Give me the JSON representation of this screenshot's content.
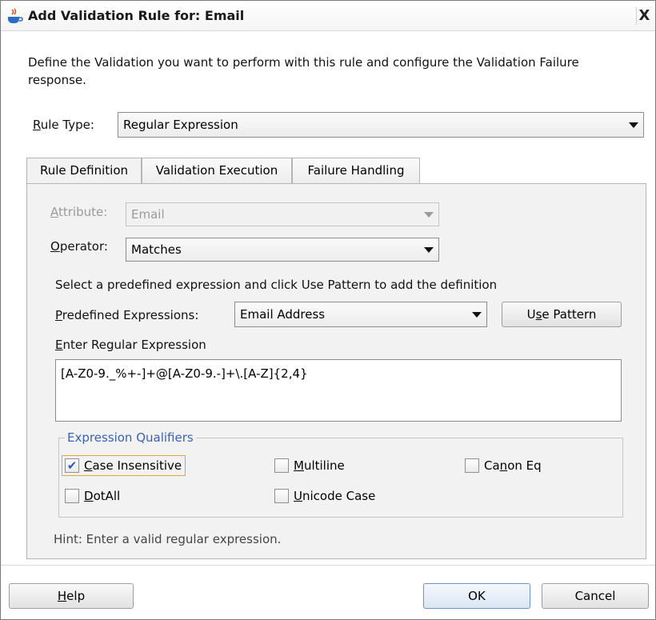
{
  "window": {
    "title": "Add Validation Rule for: Email",
    "close_label": "X",
    "app_icon": "java-cup-icon"
  },
  "description": "Define the Validation you want to perform with this rule and configure the Validation Failure response.",
  "rule_type": {
    "label_mnemonic": "R",
    "label_rest": "ule Type:",
    "value": "Regular Expression"
  },
  "tabs": [
    {
      "label": "Rule Definition",
      "active": true
    },
    {
      "label": "Validation Execution",
      "active": false
    },
    {
      "label": "Failure Handling",
      "active": false
    }
  ],
  "attribute": {
    "label_mnemonic": "A",
    "label_rest": "ttribute:",
    "value": "Email",
    "disabled": true
  },
  "operator": {
    "label_mnemonic": "O",
    "label_rest": "perator:",
    "value": "Matches"
  },
  "predefined_instruction": "Select a predefined expression and click Use Pattern to add the definition",
  "predefined": {
    "label_mnemonic": "P",
    "label_rest": "redefined Expressions:",
    "value": "Email Address"
  },
  "use_pattern_button": {
    "pre": "U",
    "mnemonic": "s",
    "post": "e Pattern"
  },
  "regex": {
    "label_mnemonic": "E",
    "label_rest": "nter Regular Expression",
    "value": "[A-Z0-9._%+-]+@[A-Z0-9.-]+\\.[A-Z]{2,4}"
  },
  "qualifiers": {
    "legend": "Expression Qualifiers",
    "items": [
      {
        "pre": "",
        "mnemonic": "C",
        "post": "ase Insensitive",
        "checked": true
      },
      {
        "pre": "",
        "mnemonic": "M",
        "post": "ultiline",
        "checked": false
      },
      {
        "pre": "Ca",
        "mnemonic": "n",
        "post": "on Eq",
        "checked": false
      },
      {
        "pre": "",
        "mnemonic": "D",
        "post": "otAll",
        "checked": false
      },
      {
        "pre": "",
        "mnemonic": "U",
        "post": "nicode Case",
        "checked": false
      }
    ]
  },
  "hint": "Hint: Enter a valid regular expression.",
  "buttons": {
    "help_mnemonic": "H",
    "help_rest": "elp",
    "ok": "OK",
    "cancel": "Cancel"
  }
}
